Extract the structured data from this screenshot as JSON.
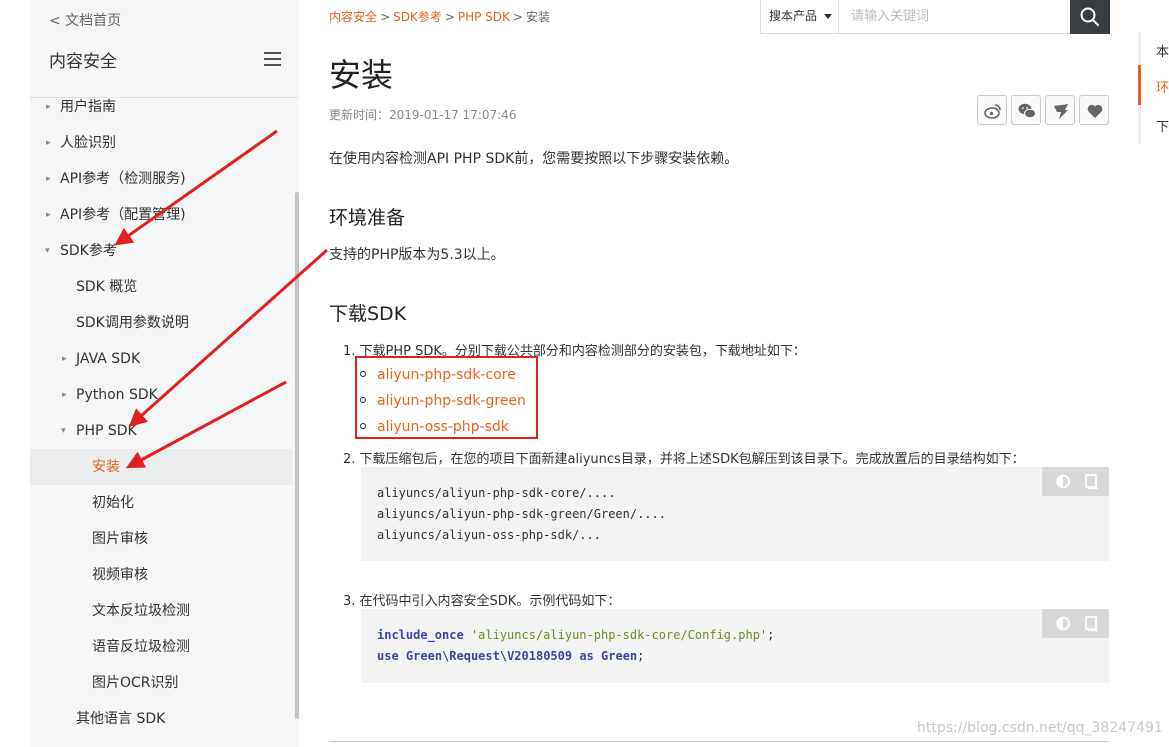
{
  "sidebar": {
    "back_label": "< 文档首页",
    "title": "内容安全",
    "items": [
      {
        "label": "用户指南",
        "caret": "▸"
      },
      {
        "label": "人脸识别",
        "caret": "▸"
      },
      {
        "label": "API参考（检测服务)",
        "caret": "▸"
      },
      {
        "label": "API参考（配置管理)",
        "caret": "▸"
      },
      {
        "label": "SDK参考",
        "caret": "▾"
      },
      {
        "label": "SDK 概览",
        "caret": ""
      },
      {
        "label": "SDK调用参数说明",
        "caret": ""
      },
      {
        "label": "JAVA SDK",
        "caret": "▸"
      },
      {
        "label": "Python SDK",
        "caret": "▸"
      },
      {
        "label": "PHP SDK",
        "caret": "▾"
      },
      {
        "label": "安装",
        "caret": ""
      },
      {
        "label": "初始化",
        "caret": ""
      },
      {
        "label": "图片审核",
        "caret": ""
      },
      {
        "label": "视频审核",
        "caret": ""
      },
      {
        "label": "文本反垃圾检测",
        "caret": ""
      },
      {
        "label": "语音反垃圾检测",
        "caret": ""
      },
      {
        "label": "图片OCR识别",
        "caret": ""
      },
      {
        "label": "其他语言 SDK",
        "caret": ""
      }
    ]
  },
  "breadcrumb": {
    "items": [
      "内容安全",
      "SDK参考",
      "PHP SDK"
    ],
    "current": "安装",
    "separator": ">"
  },
  "search": {
    "scope_label": "搜本产品",
    "placeholder": "请输入关键词"
  },
  "page": {
    "title": "安装",
    "updated": "更新时间：2019-01-17 17:07:46",
    "intro": "在使用内容检测API PHP SDK前，您需要按照以下步骤安装依赖。",
    "section1_title": "环境准备",
    "section1_text": "支持的PHP版本为5.3以上。",
    "section2_title": "下载SDK",
    "step1_num": "1.",
    "step1_text": "下载PHP SDK。分别下载公共部分和内容检测部分的安装包，下载地址如下：",
    "links": [
      "aliyun-php-sdk-core",
      "aliyun-php-sdk-green",
      "aliyun-oss-php-sdk"
    ],
    "step2_num": "2.",
    "step2_text": "下载压缩包后，在您的项目下面新建aliyuncs目录，并将上述SDK包解压到该目录下。完成放置后的目录结构如下：",
    "code1": [
      "aliyuncs/aliyun-php-sdk-core/....",
      "aliyuncs/aliyun-php-sdk-green/Green/....",
      "aliyuncs/aliyun-oss-php-sdk/..."
    ],
    "step3_num": "3.",
    "step3_text": "在代码中引入内容安全SDK。示例代码如下：",
    "code2": {
      "line1_kw": "include_once",
      "line1_str": "'aliyuncs/aliyun-php-sdk-core/Config.php'",
      "line1_end": ";",
      "line2_kw1": "use",
      "line2_ns": "Green\\Request\\V20180509",
      "line2_kw2": "as",
      "line2_alias": "Green",
      "line2_end": ";"
    }
  },
  "share_icons": [
    "weibo-icon",
    "wechat-icon",
    "dingtalk-icon",
    "like-icon"
  ],
  "toc": {
    "items": [
      "本",
      "环",
      "下"
    ],
    "active_index": 1
  },
  "watermark": "https://blog.csdn.net/qq_38247491",
  "colors": {
    "accent": "#e8631f",
    "annotation_red": "#e02020",
    "search_button": "#373d41",
    "sidebar_bg": "#f5f6f7"
  }
}
